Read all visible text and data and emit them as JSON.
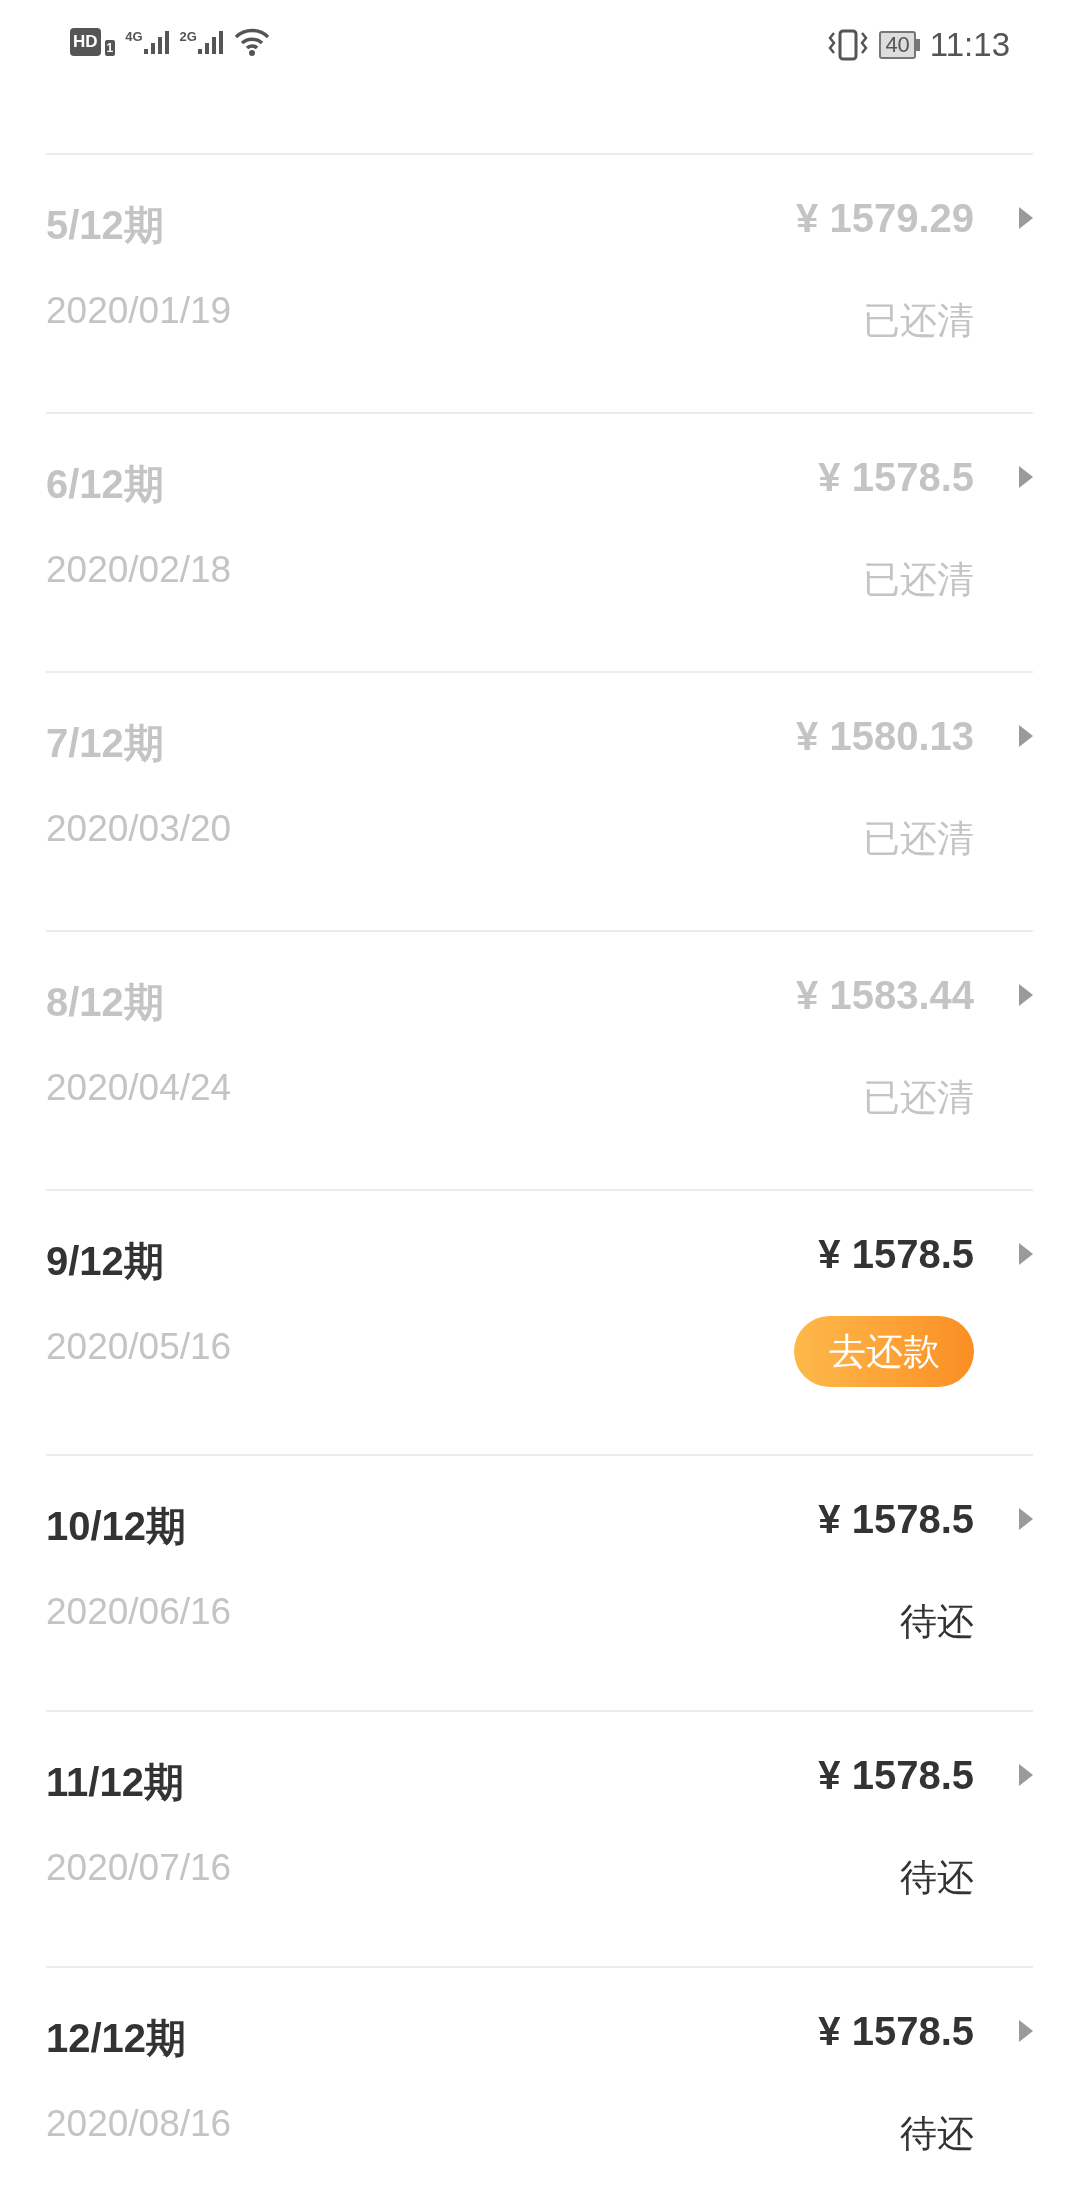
{
  "status_bar": {
    "hd_label": "HD",
    "sim_label": "1",
    "network_1": "4G",
    "network_2": "2G",
    "battery": "40",
    "time": "11:13"
  },
  "installments": [
    {
      "period": "5/12期",
      "date": "2020/01/19",
      "amount": "¥ 1579.29",
      "kind": "paid",
      "status": "已还清"
    },
    {
      "period": "6/12期",
      "date": "2020/02/18",
      "amount": "¥ 1578.5",
      "kind": "paid",
      "status": "已还清"
    },
    {
      "period": "7/12期",
      "date": "2020/03/20",
      "amount": "¥ 1580.13",
      "kind": "paid",
      "status": "已还清"
    },
    {
      "period": "8/12期",
      "date": "2020/04/24",
      "amount": "¥ 1583.44",
      "kind": "paid",
      "status": "已还清"
    },
    {
      "period": "9/12期",
      "date": "2020/05/16",
      "amount": "¥ 1578.5",
      "kind": "due",
      "status": "去还款"
    },
    {
      "period": "10/12期",
      "date": "2020/06/16",
      "amount": "¥ 1578.5",
      "kind": "pending",
      "status": "待还"
    },
    {
      "period": "11/12期",
      "date": "2020/07/16",
      "amount": "¥ 1578.5",
      "kind": "pending",
      "status": "待还"
    },
    {
      "period": "12/12期",
      "date": "2020/08/16",
      "amount": "¥ 1578.5",
      "kind": "pending",
      "status": "待还"
    }
  ]
}
